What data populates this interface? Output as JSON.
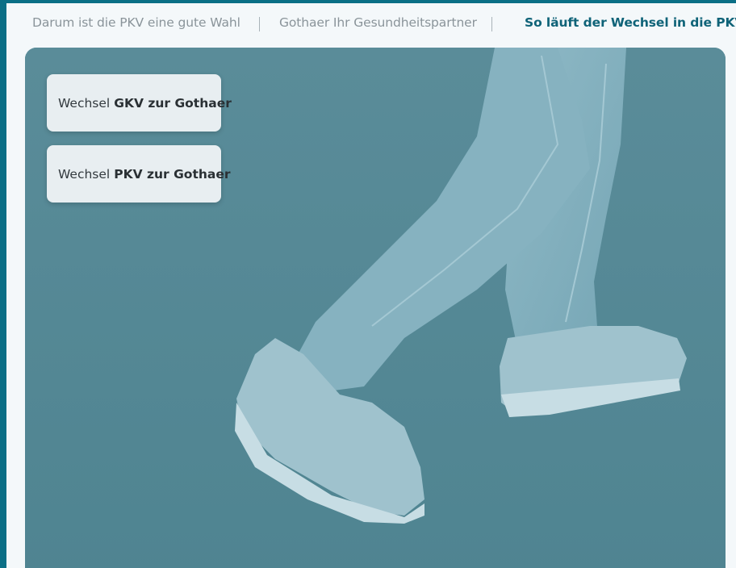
{
  "tabs": [
    {
      "label": "Darum ist die PKV eine gute Wahl",
      "active": false
    },
    {
      "label": "Gothaer Ihr Gesundheitspartner",
      "active": false
    },
    {
      "label": "So läuft der Wechsel in die PKV",
      "active": true
    }
  ],
  "buttons": [
    {
      "prefix": "Wechsel",
      "bold": "GKV zur Gothaer"
    },
    {
      "prefix": "Wechsel",
      "bold": "PKV zur Gothaer"
    }
  ],
  "colors": {
    "brand": "#0b6f86",
    "active_tab": "#0f6378",
    "hero_overlay": "#5f919e"
  }
}
